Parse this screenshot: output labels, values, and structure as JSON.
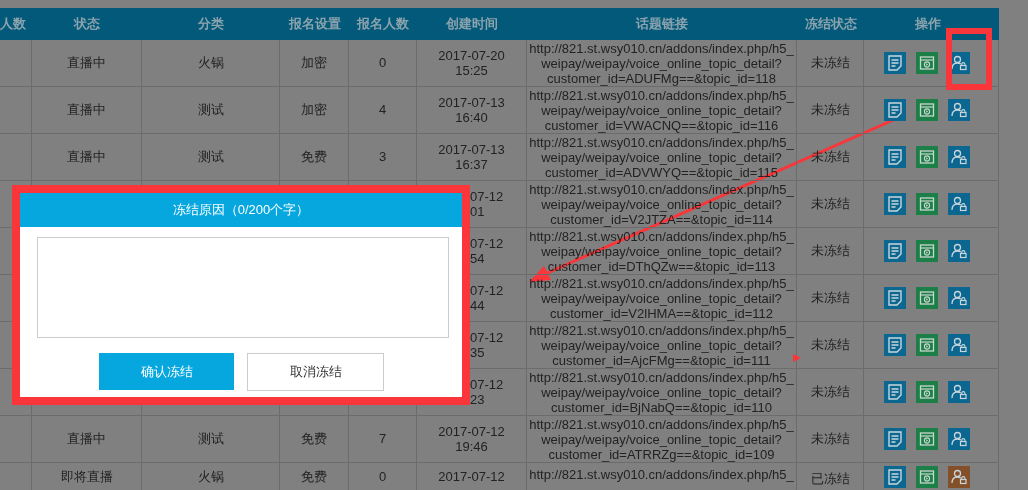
{
  "table": {
    "columns": [
      "人数",
      "状态",
      "分类",
      "报名设置",
      "报名人数",
      "创建时间",
      "话题链接",
      "冻结状态",
      "操作"
    ],
    "rows": [
      {
        "kind": "full",
        "status": "直播中",
        "category": "火锅",
        "signup_setting": "加密",
        "signup_count": "0",
        "created": [
          "2017-07-20",
          "15:25"
        ],
        "link": [
          "http://821.st.wsy010.cn/addons/index.php/h5_",
          "weipay/weipay/voice_online_topic_detail?",
          "customer_id=ADUFMg==&topic_id=118"
        ],
        "freeze_status": "未冻结",
        "frozen": false
      },
      {
        "kind": "full",
        "status": "直播中",
        "category": "测试",
        "signup_setting": "加密",
        "signup_count": "4",
        "created": [
          "2017-07-13",
          "16:40"
        ],
        "link": [
          "http://821.st.wsy010.cn/addons/index.php/h5_",
          "weipay/weipay/voice_online_topic_detail?",
          "customer_id=VWACNQ==&topic_id=116"
        ],
        "freeze_status": "未冻结",
        "frozen": false
      },
      {
        "kind": "full",
        "status": "直播中",
        "category": "测试",
        "signup_setting": "免费",
        "signup_count": "3",
        "created": [
          "2017-07-13",
          "16:37"
        ],
        "link": [
          "http://821.st.wsy010.cn/addons/index.php/h5_",
          "weipay/weipay/voice_online_topic_detail?",
          "customer_id=ADVWYQ==&topic_id=115"
        ],
        "freeze_status": "未冻结",
        "frozen": false
      },
      {
        "kind": "covered",
        "created": [
          "07-12",
          "01"
        ],
        "link": [
          "http://821.st.wsy010.cn/addons/index.php/h5_",
          "weipay/weipay/voice_online_topic_detail?",
          "customer_id=V2JTZA==&topic_id=114"
        ],
        "freeze_status": "未冻结",
        "frozen": false
      },
      {
        "kind": "covered",
        "created": [
          "07-12",
          "54"
        ],
        "link": [
          "http://821.st.wsy010.cn/addons/index.php/h5_",
          "weipay/weipay/voice_online_topic_detail?",
          "customer_id=DThQZw==&topic_id=113"
        ],
        "freeze_status": "未冻结",
        "frozen": false
      },
      {
        "kind": "covered",
        "created": [
          "07-12",
          "44"
        ],
        "link": [
          "http://821.st.wsy010.cn/addons/index.php/h5_",
          "weipay/weipay/voice_online_topic_detail?",
          "customer_id=V2lHMA==&topic_id=112"
        ],
        "freeze_status": "未冻结",
        "frozen": false
      },
      {
        "kind": "covered",
        "created": [
          "07-12",
          "35"
        ],
        "link": [
          "http://821.st.wsy010.cn/addons/index.php/h5_",
          "weipay/weipay/voice_online_topic_detail?",
          "customer_id=AjcFMg==&topic_id=111"
        ],
        "freeze_status": "未冻结",
        "frozen": false
      },
      {
        "kind": "covered",
        "created": [
          "07-12",
          "23"
        ],
        "link": [
          "http://821.st.wsy010.cn/addons/index.php/h5_",
          "weipay/weipay/voice_online_topic_detail?",
          "customer_id=BjNabQ==&topic_id=110"
        ],
        "freeze_status": "未冻结",
        "frozen": false
      },
      {
        "kind": "full",
        "status": "直播中",
        "category": "测试",
        "signup_setting": "免费",
        "signup_count": "7",
        "created": [
          "2017-07-12",
          "19:46"
        ],
        "link": [
          "http://821.st.wsy010.cn/addons/index.php/h5_",
          "weipay/weipay/voice_online_topic_detail?",
          "customer_id=ATRRZg==&topic_id=109"
        ],
        "freeze_status": "未冻结",
        "frozen": false
      },
      {
        "kind": "full",
        "status": "即将直播",
        "category": "火锅",
        "signup_setting": "免费",
        "signup_count": "0",
        "created": [
          "2017-07-12"
        ],
        "link": [
          "http://821.st.wsy010.cn/addons/index.php/h5_"
        ],
        "freeze_status": "已冻结",
        "frozen": true
      }
    ]
  },
  "dialog": {
    "title": "冻结原因（0/200个字）",
    "confirm": "确认冻结",
    "cancel": "取消冻结"
  }
}
